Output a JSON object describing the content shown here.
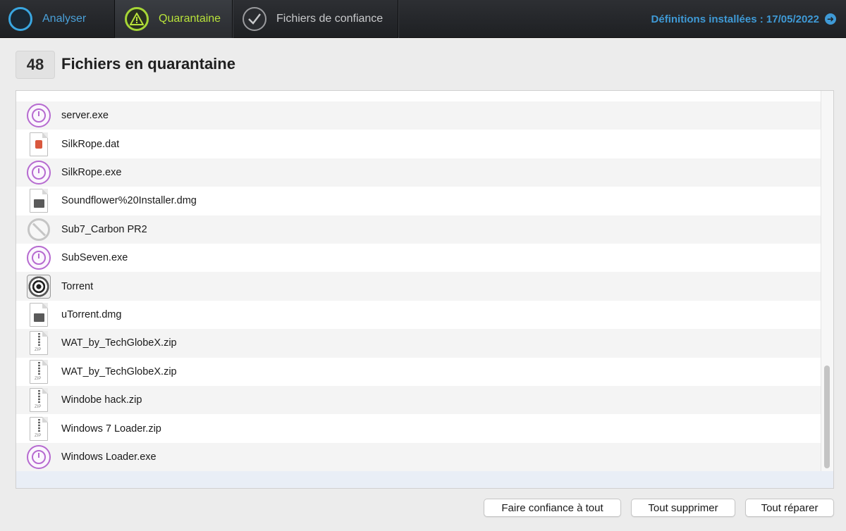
{
  "toolbar": {
    "tabs": [
      {
        "label": "Analyser",
        "icon": "refresh-icon"
      },
      {
        "label": "Quarantaine",
        "icon": "warning-icon"
      },
      {
        "label": "Fichiers de confiance",
        "icon": "checkmark-icon"
      }
    ],
    "definitions": "Définitions installées : 17/05/2022"
  },
  "header": {
    "count": "48",
    "title": "Fichiers en quarantaine"
  },
  "files": [
    {
      "name": "server.exe",
      "icon": "exe"
    },
    {
      "name": "SilkRope.dat",
      "icon": "dat"
    },
    {
      "name": "SilkRope.exe",
      "icon": "exe"
    },
    {
      "name": "Soundflower%20Installer.dmg",
      "icon": "dmg"
    },
    {
      "name": "Sub7_Carbon PR2",
      "icon": "blocked"
    },
    {
      "name": "SubSeven.exe",
      "icon": "exe"
    },
    {
      "name": "Torrent",
      "icon": "torrent"
    },
    {
      "name": "uTorrent.dmg",
      "icon": "dmg"
    },
    {
      "name": "WAT_by_TechGlobeX.zip",
      "icon": "zip"
    },
    {
      "name": "WAT_by_TechGlobeX.zip",
      "icon": "zip"
    },
    {
      "name": "Windobe hack.zip",
      "icon": "zip"
    },
    {
      "name": "Windows 7 Loader.zip",
      "icon": "zip"
    },
    {
      "name": "Windows Loader.exe",
      "icon": "exe"
    }
  ],
  "actions": {
    "trust_all": "Faire confiance à tout",
    "delete_all": "Tout supprimer",
    "repair_all": "Tout réparer"
  },
  "colors": {
    "accent_blue": "#3f9ad6",
    "accent_green": "#b9e33a",
    "exe_purple": "#b66ad0"
  }
}
